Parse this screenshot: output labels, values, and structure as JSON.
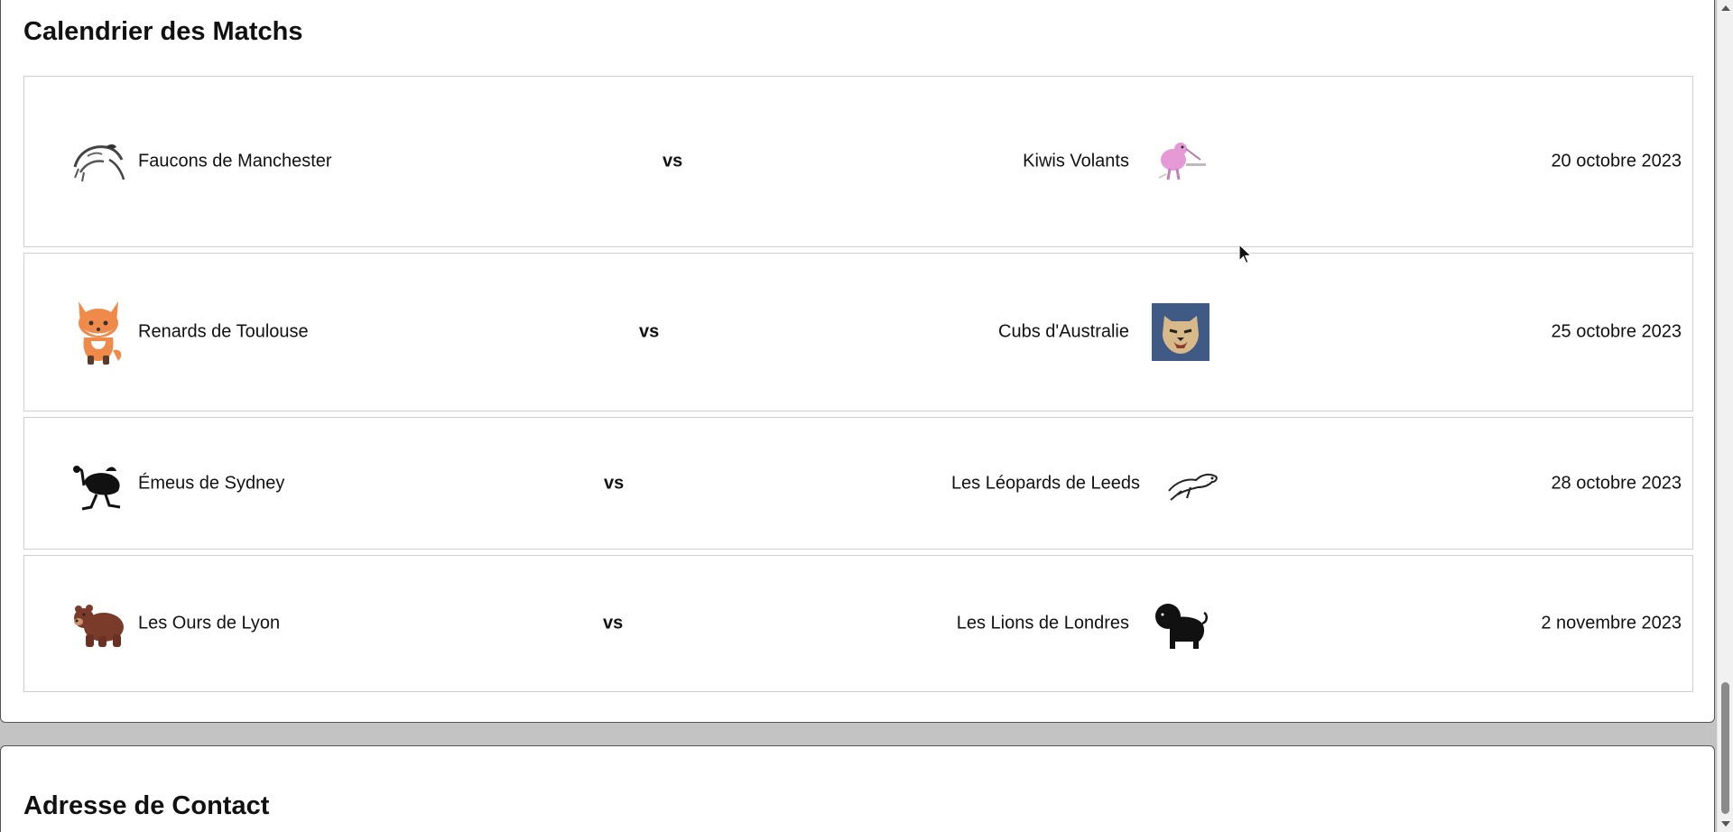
{
  "schedule": {
    "title": "Calendrier des Matchs",
    "matches": [
      {
        "home": {
          "name": "Faucons de Manchester",
          "icon": "falcon-logo-icon"
        },
        "vs": "vs",
        "away": {
          "name": "Kiwis Volants",
          "icon": "kiwi-logo-icon"
        },
        "date": "20 octobre 2023"
      },
      {
        "home": {
          "name": "Renards de Toulouse",
          "icon": "fox-logo-icon"
        },
        "vs": "vs",
        "away": {
          "name": "Cubs d'Australie",
          "icon": "cub-logo-icon"
        },
        "date": "25 octobre 2023"
      },
      {
        "home": {
          "name": "Émeus de Sydney",
          "icon": "emu-logo-icon"
        },
        "vs": "vs",
        "away": {
          "name": "Les Léopards de Leeds",
          "icon": "leopard-logo-icon"
        },
        "date": "28 octobre 2023"
      },
      {
        "home": {
          "name": "Les Ours de Lyon",
          "icon": "bear-logo-icon"
        },
        "vs": "vs",
        "away": {
          "name": "Les Lions de Londres",
          "icon": "lion-logo-icon"
        },
        "date": "2 novembre 2023"
      }
    ]
  },
  "contact": {
    "title": "Adresse de Contact"
  },
  "colors": {
    "page_background": "#c3c3c3",
    "card_background": "#ffffff",
    "row_border": "#cfcfcf",
    "cub_logo_background": "#3f5a84",
    "fox_orange": "#f08a4b",
    "bear_brown": "#7a3b2a",
    "kiwi_pink": "#e59ad6"
  }
}
